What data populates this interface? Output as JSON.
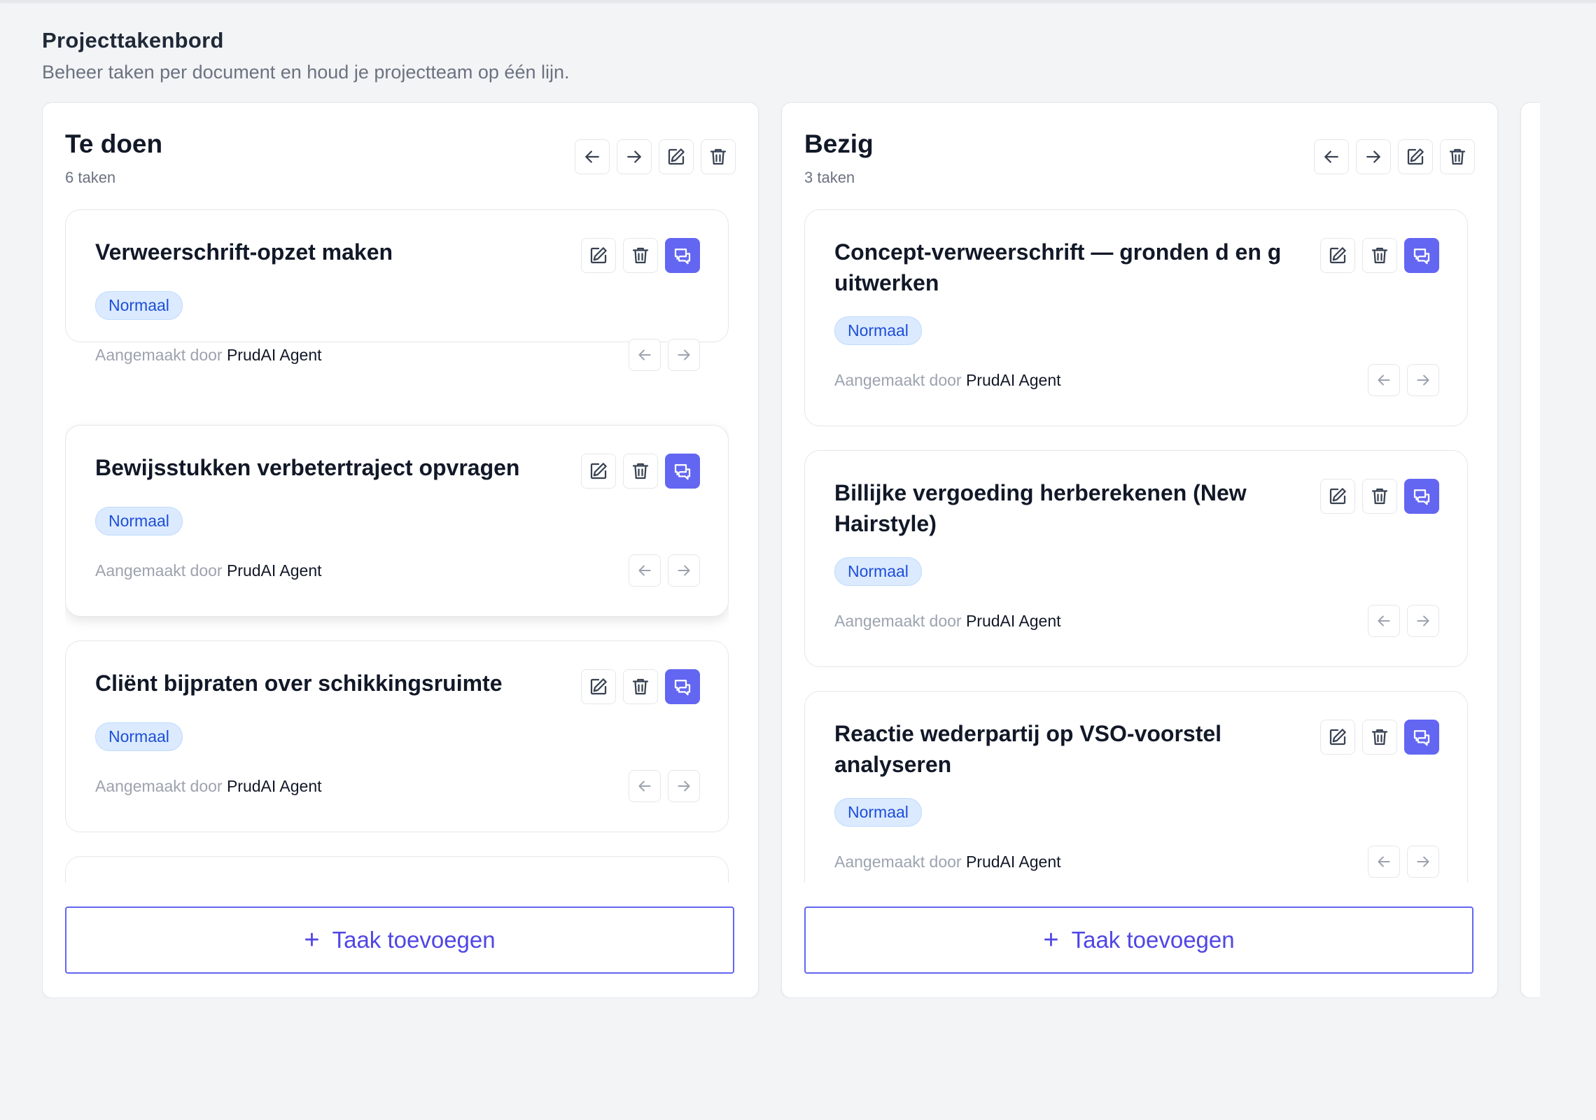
{
  "page": {
    "title": "Projecttakenbord",
    "subtitle": "Beheer taken per document en houd je projectteam op één lijn."
  },
  "colors": {
    "accent": "#6366f1",
    "badge_bg": "#dbeafe",
    "badge_text": "#1d4ed8",
    "background": "#f3f4f6"
  },
  "icons": {
    "column_actions": [
      "arrow-left-icon",
      "arrow-right-icon",
      "edit-icon",
      "trash-icon"
    ],
    "card_actions": [
      "edit-icon",
      "trash-icon",
      "chat-icon"
    ],
    "card_nav": [
      "arrow-left-icon",
      "arrow-right-icon"
    ],
    "add": "plus-icon"
  },
  "columns": [
    {
      "title": "Te doen",
      "count": "6 taken",
      "add_label": "Taak toevoegen",
      "cards": [
        {
          "title": "Verweerschrift-opzet maken",
          "priority": "Normaal",
          "created_by_label": "Aangemaakt door",
          "author": "PrudAI Agent"
        },
        {
          "title": "Bewijsstukken verbetertraject opvragen",
          "priority": "Normaal",
          "created_by_label": "Aangemaakt door",
          "author": "PrudAI Agent"
        },
        {
          "title": "Cliënt bijpraten over schikkingsruimte",
          "priority": "Normaal",
          "created_by_label": "Aangemaakt door",
          "author": "PrudAI Agent"
        }
      ]
    },
    {
      "title": "Bezig",
      "count": "3 taken",
      "add_label": "Taak toevoegen",
      "cards": [
        {
          "title": "Concept-verweerschrift — gronden d en g uitwerken",
          "priority": "Normaal",
          "created_by_label": "Aangemaakt door",
          "author": "PrudAI Agent"
        },
        {
          "title": "Billijke vergoeding herberekenen (New Hairstyle)",
          "priority": "Normaal",
          "created_by_label": "Aangemaakt door",
          "author": "PrudAI Agent"
        },
        {
          "title": "Reactie wederpartij op VSO-voorstel analyseren",
          "priority": "Normaal",
          "created_by_label": "Aangemaakt door",
          "author": "PrudAI Agent"
        }
      ]
    }
  ]
}
